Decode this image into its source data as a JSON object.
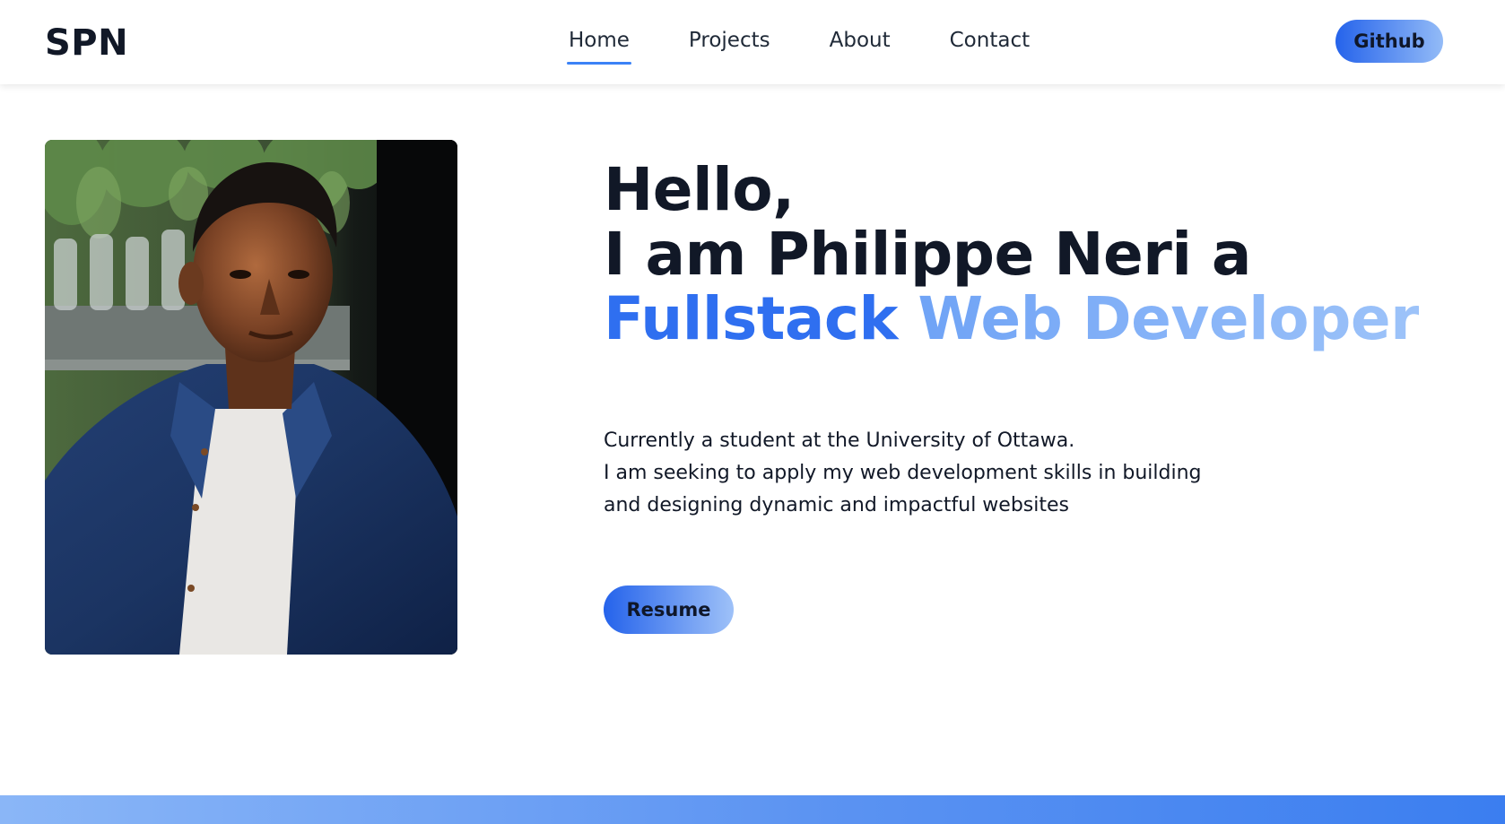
{
  "header": {
    "logo": "SPN",
    "nav": [
      {
        "label": "Home",
        "active": true
      },
      {
        "label": "Projects",
        "active": false
      },
      {
        "label": "About",
        "active": false
      },
      {
        "label": "Contact",
        "active": false
      }
    ],
    "github_label": "Github"
  },
  "hero": {
    "portrait_icon": "portrait-photo",
    "headline_line1": "Hello,",
    "headline_line2": "I am Philippe Neri a",
    "headline_highlight_1": "Fullstack",
    "headline_highlight_2": "Web Developer",
    "bio_line1": "Currently a student at the University of Ottawa.",
    "bio_line2": "I am seeking to apply my web development skills in building",
    "bio_line3": "and designing dynamic and impactful websites",
    "resume_label": "Resume"
  },
  "colors": {
    "accent": "#3b82f6",
    "accent_dark": "#2563eb",
    "accent_light": "#9dc3f9",
    "text": "#111827"
  }
}
